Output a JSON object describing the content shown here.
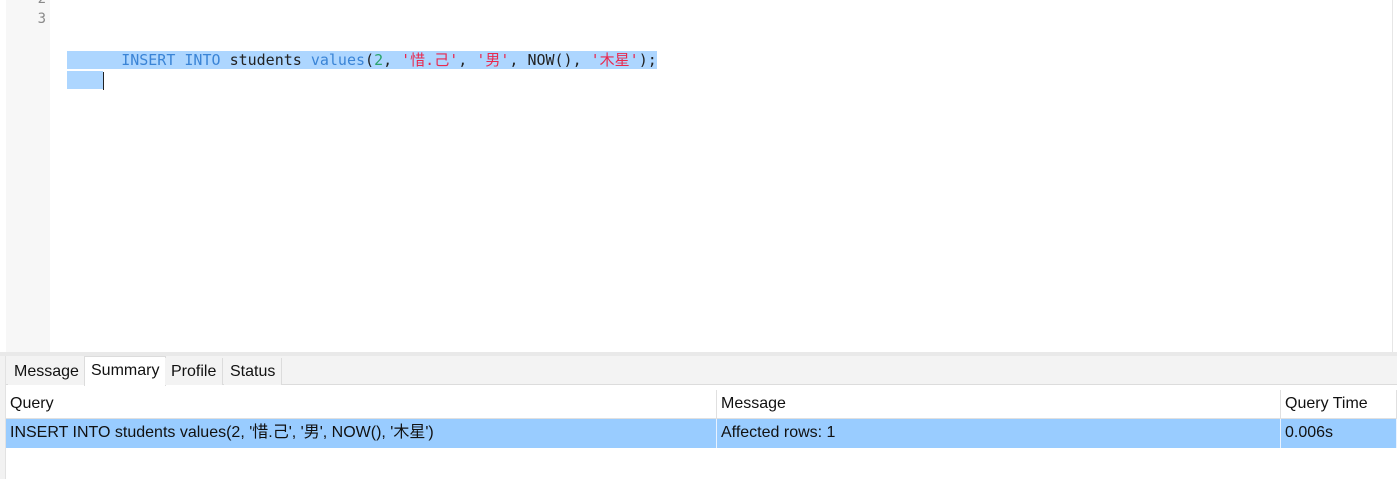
{
  "editor": {
    "line_numbers": [
      "2",
      "3"
    ],
    "code_tokens": [
      {
        "text": "INSERT",
        "kind": "kw"
      },
      {
        "text": " ",
        "kind": "punct"
      },
      {
        "text": "INTO",
        "kind": "kw"
      },
      {
        "text": " ",
        "kind": "punct"
      },
      {
        "text": "students",
        "kind": "id"
      },
      {
        "text": " ",
        "kind": "punct"
      },
      {
        "text": "values",
        "kind": "kw"
      },
      {
        "text": "(",
        "kind": "punct"
      },
      {
        "text": "2",
        "kind": "num"
      },
      {
        "text": ", ",
        "kind": "punct"
      },
      {
        "text": "'惜.己'",
        "kind": "str"
      },
      {
        "text": ", ",
        "kind": "punct"
      },
      {
        "text": "'男'",
        "kind": "str"
      },
      {
        "text": ", ",
        "kind": "punct"
      },
      {
        "text": "NOW()",
        "kind": "id"
      },
      {
        "text": ", ",
        "kind": "punct"
      },
      {
        "text": "'木星'",
        "kind": "str"
      },
      {
        "text": ");",
        "kind": "punct"
      }
    ]
  },
  "result_tabs": [
    {
      "label": "Message",
      "active": false
    },
    {
      "label": "Summary",
      "active": true
    },
    {
      "label": "Profile",
      "active": false
    },
    {
      "label": "Status",
      "active": false
    }
  ],
  "summary_table": {
    "columns": [
      "Query",
      "Message",
      "Query Time"
    ],
    "rows": [
      [
        "INSERT INTO students values(2, '惜.己', '男', NOW(), '木星')",
        "Affected rows: 1",
        "0.006s"
      ]
    ]
  },
  "colors": {
    "selection": "#add6ff",
    "row_selected": "#99ccff",
    "keyword": "#3a84d6",
    "string": "#e8294f",
    "number": "#2aa36a"
  }
}
